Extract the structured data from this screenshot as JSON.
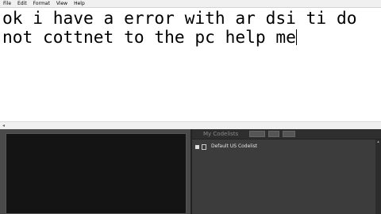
{
  "menu": [
    "File",
    "Edit",
    "Format",
    "View",
    "Help"
  ],
  "editor": {
    "line1": "ok i have a error with ar dsi ti do",
    "line2": "not cottnet to the pc help me"
  },
  "codelists_panel": {
    "title": "My Codelists",
    "items": [
      {
        "label": "Default US Codelist"
      }
    ]
  },
  "scroll_arrows": {
    "left": "◂",
    "up": "▴"
  }
}
